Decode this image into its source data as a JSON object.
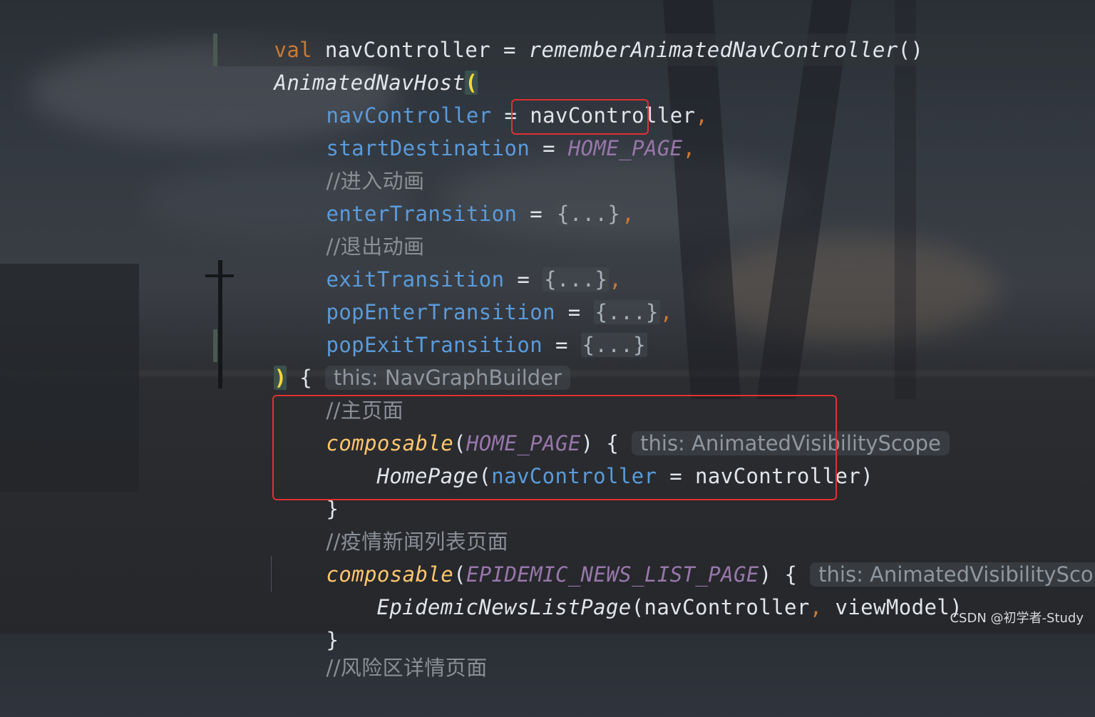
{
  "code": {
    "line1": {
      "kw": "val",
      "name": " navController = ",
      "call": "rememberAnimatedNavController",
      "parens": "()"
    },
    "line2": {
      "fn": "AnimatedNavHost",
      "paren": "("
    },
    "line3": {
      "param": "navController",
      "eq": " = ",
      "value": "navController",
      "comma": ","
    },
    "line4": {
      "param": "startDestination",
      "eq": " = ",
      "value": "HOME_PAGE",
      "comma": ","
    },
    "line5": {
      "comment": "//进入动画"
    },
    "line6": {
      "param": "enterTransition",
      "eq": " = ",
      "fold": "{...}",
      "comma": ","
    },
    "line7": {
      "comment": "//退出动画"
    },
    "line8": {
      "param": "exitTransition",
      "eq": " = ",
      "fold": "{...}",
      "comma": ","
    },
    "line9": {
      "param": "popEnterTransition",
      "eq": " = ",
      "fold": "{...}",
      "comma": ","
    },
    "line10": {
      "param": "popExitTransition",
      "eq": " = ",
      "fold": "{...}"
    },
    "line11": {
      "paren": ")",
      "brace": " { ",
      "hint": "this: NavGraphBuilder"
    },
    "line12": {
      "comment": "//主页面"
    },
    "line13": {
      "fn": "composable",
      "open": "(",
      "const": "HOME_PAGE",
      "close": ") { ",
      "hint": "this: AnimatedVisibilityScope"
    },
    "line14": {
      "fn": "HomePage",
      "open": "(",
      "param": "navController",
      "eq": " = ",
      "value": "navController",
      "close": ")"
    },
    "line15": {
      "brace": "}"
    },
    "line16": {
      "comment": "//疫情新闻列表页面"
    },
    "line17": {
      "fn": "composable",
      "open": "(",
      "const": "EPIDEMIC_NEWS_LIST_PAGE",
      "close": ") { ",
      "hint": "this: AnimatedVisibilityScope"
    },
    "line18": {
      "fn": "EpidemicNewsListPage",
      "open": "(",
      "arg1": "navController",
      "comma": ",",
      "arg2": " viewModel",
      "close": ")"
    },
    "line19": {
      "brace": "}"
    },
    "line20": {
      "comment": "//风险区详情页面"
    }
  },
  "watermark": "CSDN @初学者-Study",
  "colors": {
    "keyword": "#cc7832",
    "parameter": "#5a9bdb",
    "constant": "#9876aa",
    "comment": "#8a8f96",
    "composable": "#ffc66d",
    "highlight_box": "#e03131"
  }
}
